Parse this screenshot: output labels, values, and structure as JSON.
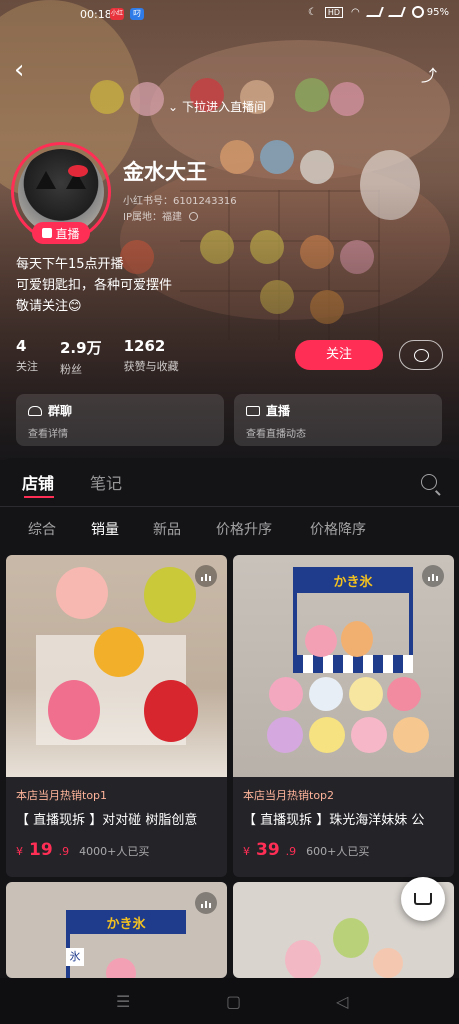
{
  "status_bar": {
    "time": "00:18",
    "app1": "小红",
    "app2": "叼",
    "battery": "95%",
    "hd": "HD"
  },
  "header": {
    "pull_hint": "下拉进入直播间"
  },
  "profile": {
    "name": "金水大王",
    "redbook_id": "小红书号：6101243316",
    "ip_location": "IP属地：福建",
    "live_badge": "直播",
    "bio": [
      "每天下午15点开播",
      "可爱钥匙扣，各种可爱摆件",
      "敬请关注😊"
    ]
  },
  "stats": [
    {
      "value": "4",
      "label": "关注"
    },
    {
      "value": "2.9万",
      "label": "粉丝"
    },
    {
      "value": "1262",
      "label": "获赞与收藏"
    }
  ],
  "actions": {
    "follow": "关注"
  },
  "cards": [
    {
      "title": "群聊",
      "subtitle": "查看详情"
    },
    {
      "title": "直播",
      "subtitle": "查看直播动态"
    }
  ],
  "tabs": {
    "shop": "店铺",
    "notes": "笔记"
  },
  "sorts": [
    "综合",
    "销量",
    "新品",
    "价格升序",
    "价格降序"
  ],
  "active_sort": "销量",
  "products": [
    {
      "top": "本店当月热销top1",
      "title": "【 直播现拆 】对对碰 树脂创意",
      "yen": "¥",
      "price": "19",
      "dec": ".9",
      "sold": "4000+人已买"
    },
    {
      "top": "本店当月热销top2",
      "title": "【 直播现拆 】珠光海洋妹妹 公",
      "yen": "¥",
      "price": "39",
      "dec": ".9",
      "sold": "600+人已买"
    }
  ],
  "stand_sign": "かき氷",
  "stand_sign_small": "氷",
  "nav": {
    "menu": "☰",
    "home": "▢",
    "back": "◁"
  },
  "colors": {
    "accent": "#ff2e55",
    "background": "#141417",
    "card": "#232328"
  }
}
